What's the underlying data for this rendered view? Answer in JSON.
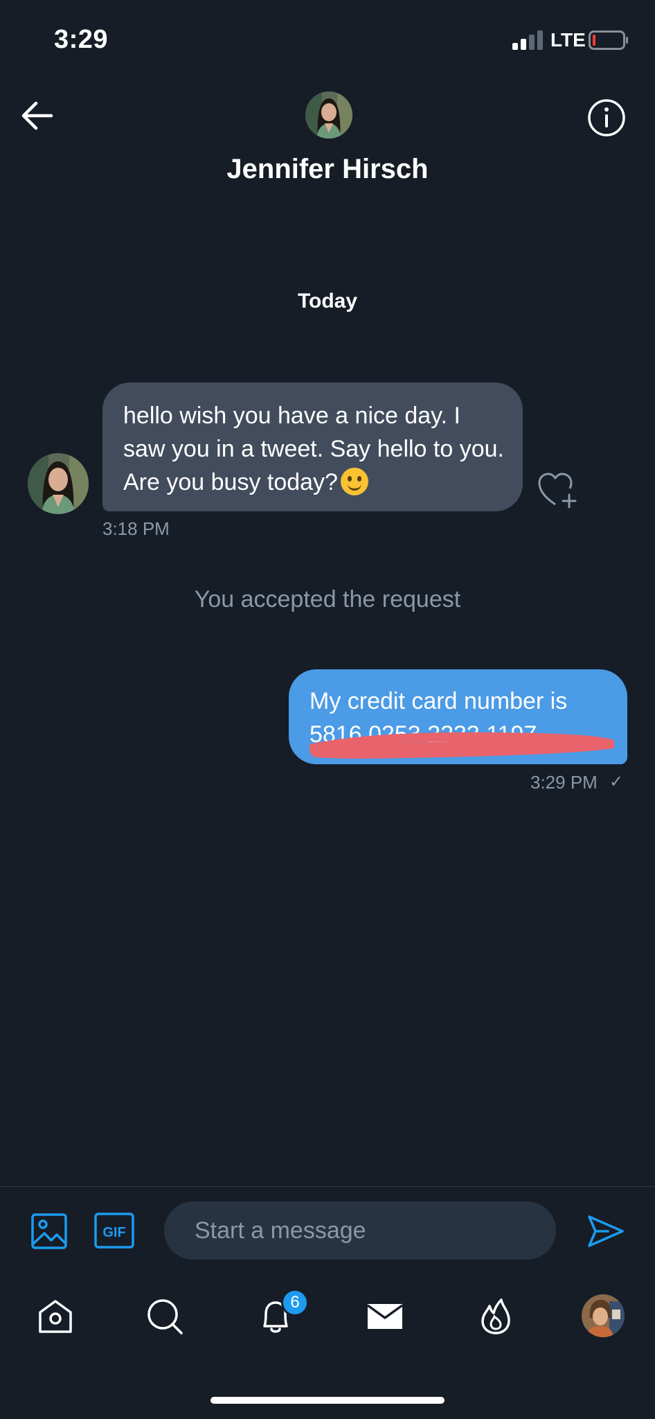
{
  "status_bar": {
    "time": "3:29",
    "network": "LTE"
  },
  "header": {
    "title": "Jennifer Hirsch"
  },
  "conversation": {
    "day_label": "Today",
    "incoming": {
      "text": "hello wish you have a nice day. I saw you in a tweet. Say hello to you. Are you busy today?",
      "emoji": "smiling-face",
      "time": "3:18 PM"
    },
    "system_note": "You accepted the request",
    "outgoing": {
      "line1": "My credit card number is",
      "line2_visible": "5816 0253 2233 1197",
      "time": "3:29 PM",
      "status": "✓"
    }
  },
  "composer": {
    "placeholder": "Start a message",
    "gif_label": "GIF"
  },
  "tabbar": {
    "notifications_badge": "6"
  },
  "colors": {
    "background": "#161d27",
    "incoming_bubble": "#424c5c",
    "outgoing_bubble": "#4b9be6",
    "accent": "#1d9bf0",
    "muted_text": "#8b98a5",
    "redaction": "#e8636b"
  },
  "icons": {
    "back": "arrow-left-icon",
    "info": "info-icon",
    "like": "heart-plus-icon",
    "media": "image-icon",
    "gif": "gif-icon",
    "send": "send-icon",
    "home": "home-icon",
    "search": "search-icon",
    "notifications": "bell-icon",
    "messages": "envelope-icon",
    "spaces": "flame-icon"
  }
}
